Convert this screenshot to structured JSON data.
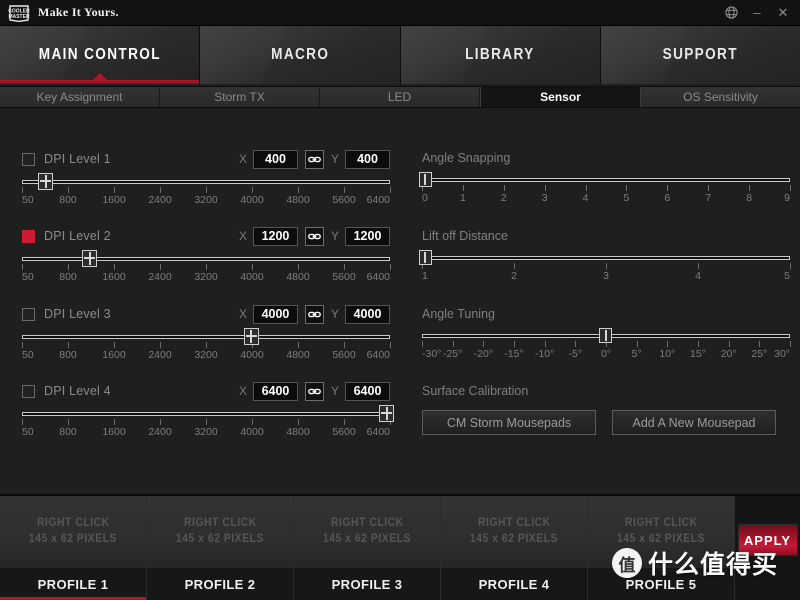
{
  "titlebar": {
    "logo_top": "COOLER",
    "logo_bottom": "MASTER",
    "tagline": "Make It Yours.",
    "globe_icon": "globe-icon",
    "minimize_icon": "minimize-icon",
    "close_icon": "close-icon"
  },
  "main_tabs": [
    {
      "label": "MAIN CONTROL",
      "active": true
    },
    {
      "label": "MACRO",
      "active": false
    },
    {
      "label": "LIBRARY",
      "active": false
    },
    {
      "label": "SUPPORT",
      "active": false
    }
  ],
  "sub_tabs": [
    {
      "label": "Key Assignment",
      "active": false
    },
    {
      "label": "Storm TX",
      "active": false
    },
    {
      "label": "LED",
      "active": false
    },
    {
      "label": "Sensor",
      "active": true
    },
    {
      "label": "OS Sensitivity",
      "active": false
    }
  ],
  "accent_color": "#b2152c",
  "dpi_levels": [
    {
      "label": "DPI Level 1",
      "checked": false,
      "x_label": "X",
      "y_label": "Y",
      "x_value": "400",
      "y_value": "400",
      "link_icon": "link-icon",
      "pct": 6.3
    },
    {
      "label": "DPI Level 2",
      "checked": true,
      "x_label": "X",
      "y_label": "Y",
      "x_value": "1200",
      "y_value": "1200",
      "link_icon": "link-icon",
      "pct": 18.3
    },
    {
      "label": "DPI Level 3",
      "checked": false,
      "x_label": "X",
      "y_label": "Y",
      "x_value": "4000",
      "y_value": "4000",
      "link_icon": "link-icon",
      "pct": 62.2
    },
    {
      "label": "DPI Level 4",
      "checked": false,
      "x_label": "X",
      "y_label": "Y",
      "x_value": "6400",
      "y_value": "6400",
      "link_icon": "link-icon",
      "pct": 99.0
    }
  ],
  "dpi_scale_labels": [
    "50",
    "800",
    "1600",
    "2400",
    "3200",
    "4000",
    "4800",
    "5600",
    "6400"
  ],
  "right_sliders": [
    {
      "title": "Angle Snapping",
      "labels": [
        "0",
        "1",
        "2",
        "3",
        "4",
        "5",
        "6",
        "7",
        "8",
        "9"
      ],
      "value_pct": 1.0
    },
    {
      "title": "Lift off Distance",
      "labels": [
        "1",
        "2",
        "3",
        "4",
        "5"
      ],
      "value_pct": 1.0
    },
    {
      "title": "Angle Tuning",
      "labels": [
        "-30°",
        "-25°",
        "-20°",
        "-15°",
        "-10°",
        "-5°",
        "0°",
        "5°",
        "10°",
        "15°",
        "20°",
        "25°",
        "30°"
      ],
      "value_pct": 50.0
    }
  ],
  "surface_calibration": {
    "title": "Surface Calibration",
    "button_a": "CM Storm Mousepads",
    "button_b": "Add A New Mousepad"
  },
  "profiles": [
    {
      "hint_line1": "RIGHT CLICK",
      "hint_line2": "145 x 62 PIXELS",
      "name": "PROFILE 1",
      "active": true
    },
    {
      "hint_line1": "RIGHT CLICK",
      "hint_line2": "145 x 62 PIXELS",
      "name": "PROFILE 2",
      "active": false
    },
    {
      "hint_line1": "RIGHT CLICK",
      "hint_line2": "145 x 62 PIXELS",
      "name": "PROFILE 3",
      "active": false
    },
    {
      "hint_line1": "RIGHT CLICK",
      "hint_line2": "145 x 62 PIXELS",
      "name": "PROFILE 4",
      "active": false
    },
    {
      "hint_line1": "RIGHT CLICK",
      "hint_line2": "145 x 62 PIXELS",
      "name": "PROFILE 5",
      "active": false
    }
  ],
  "apply_button": "APPLY",
  "watermark": {
    "badge": "值",
    "text": "什么值得买"
  }
}
